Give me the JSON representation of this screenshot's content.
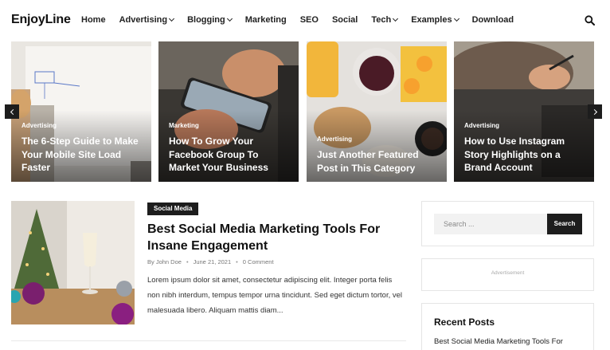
{
  "header": {
    "logo": "EnjoyLine",
    "nav": [
      {
        "label": "Home",
        "dropdown": false
      },
      {
        "label": "Advertising",
        "dropdown": true
      },
      {
        "label": "Blogging",
        "dropdown": true
      },
      {
        "label": "Marketing",
        "dropdown": false
      },
      {
        "label": "SEO",
        "dropdown": false
      },
      {
        "label": "Social",
        "dropdown": false
      },
      {
        "label": "Tech",
        "dropdown": true
      },
      {
        "label": "Examples",
        "dropdown": true
      },
      {
        "label": "Download",
        "dropdown": false
      }
    ],
    "search_icon": "search-icon"
  },
  "slider": {
    "slides": [
      {
        "category": "Advertising",
        "title": "The 6-Step Guide to Make Your Mobile Site Load Faster"
      },
      {
        "category": "Marketing",
        "title": "How To Grow Your Facebook Group To Market Your Business"
      },
      {
        "category": "Advertising",
        "title": "Just Another Featured Post in This Category"
      },
      {
        "category": "Advertising",
        "title": "How to Use Instagram Story Highlights on a Brand Account"
      }
    ],
    "prev_icon": "chevron-left-icon",
    "next_icon": "chevron-right-icon"
  },
  "post": {
    "category": "Social Media",
    "title": "Best Social Media Marketing Tools For Insane Engagement",
    "author": "By John Doe",
    "date": "June 21, 2021",
    "comments": "0 Comment",
    "excerpt": "Lorem ipsum dolor sit amet, consectetur adipiscing elit. Integer porta felis non nibh interdum, tempus tempor urna tincidunt. Sed eget dictum tortor, vel malesuada libero. Aliquam mattis diam..."
  },
  "sidebar": {
    "search_placeholder": "Search ...",
    "search_button": "Search",
    "ad_label": "Advertisement",
    "recent_heading": "Recent Posts",
    "recent_posts": [
      "Best Social Media Marketing Tools For"
    ]
  },
  "colors": {
    "dark": "#1d1d1d",
    "text": "#111111",
    "border": "#e5e5e5"
  }
}
